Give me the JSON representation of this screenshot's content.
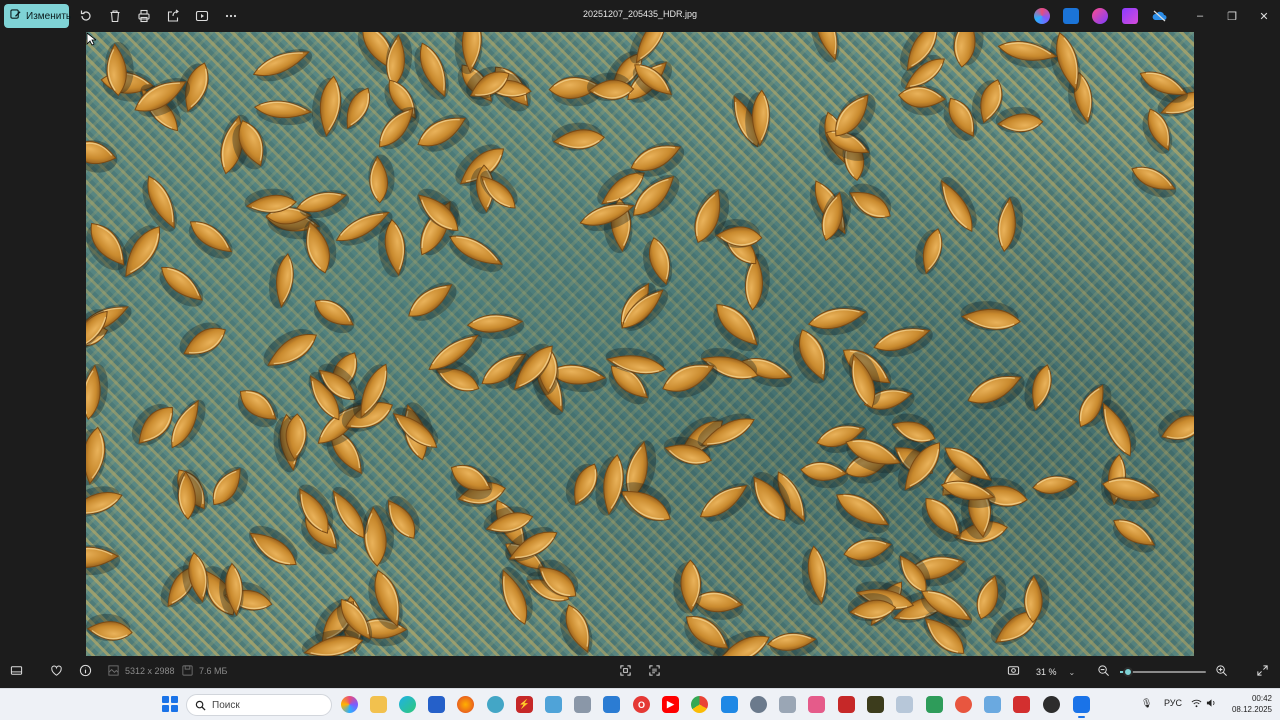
{
  "titlebar": {
    "edit_label": "Изменить",
    "file_name": "20251207_205435_HDR.jpg",
    "accent": "#7fd3d6"
  },
  "photo": {
    "subject": "pumpkin seeds on a teal and olive knitted carpet"
  },
  "statusbar": {
    "resolution": "5312 x 2988",
    "file_size": "7.6 МБ",
    "zoom_value": "31 %",
    "zoom_fraction": 0.09
  },
  "taskbar": {
    "search_placeholder": "Поиск",
    "language": "РУС",
    "time": "00:42",
    "date": "08.12.2025"
  }
}
